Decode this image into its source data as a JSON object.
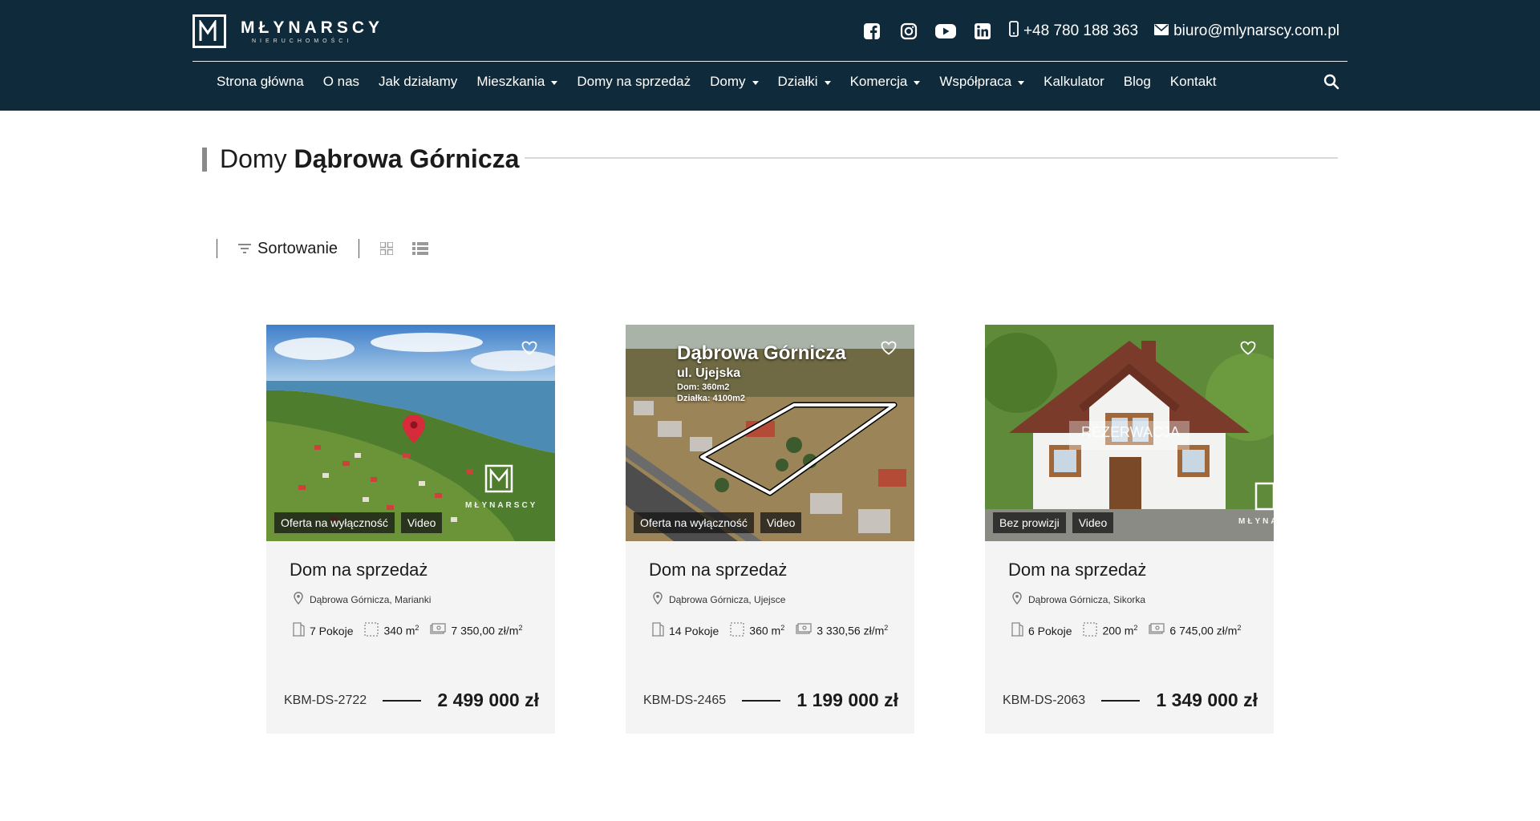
{
  "colors": {
    "header_bg": "#0f2a3a",
    "card_bg": "#f4f4f4",
    "text": "#1b1b1b",
    "pin": "#d62b3b"
  },
  "brand": {
    "name": "MŁYNARSCY",
    "subtitle": "NIERUCHOMOŚCI"
  },
  "contact": {
    "phone": "+48 780 188 363",
    "email": "biuro@mlynarscy.com.pl"
  },
  "social": [
    "facebook-icon",
    "instagram-icon",
    "youtube-icon",
    "linkedin-icon"
  ],
  "nav": {
    "items": [
      {
        "label": "Strona główna"
      },
      {
        "label": "O nas"
      },
      {
        "label": "Jak działamy"
      },
      {
        "label": "Mieszkania"
      },
      {
        "label": "Domy na sprzedaż"
      },
      {
        "label": "Domy"
      },
      {
        "label": "Działki"
      },
      {
        "label": "Komercja"
      },
      {
        "label": "Współpraca"
      },
      {
        "label": "Kalkulator"
      },
      {
        "label": "Blog"
      },
      {
        "label": "Kontakt"
      }
    ]
  },
  "page": {
    "title_light": "Domy",
    "title_bold": "Dąbrowa Górnicza"
  },
  "toolbar": {
    "sort_label": "Sortowanie"
  },
  "cards": [
    {
      "badges": [
        "Oferta na wyłączność",
        "Video"
      ],
      "title": "Dom na sprzedaż",
      "location": "Dąbrowa Górnicza, Marianki",
      "rooms": "7 Pokoje",
      "area": "340 m",
      "price_per_m": "7 350,00 zł/m",
      "code": "KBM-DS-2722",
      "price": "2 499 000 zł",
      "watermark": "MŁYNARSCY"
    },
    {
      "badges": [
        "Oferta na wyłączność",
        "Video"
      ],
      "title": "Dom na sprzedaż",
      "location": "Dąbrowa Górnicza, Ujejsce",
      "rooms": "14 Pokoje",
      "area": "360 m",
      "price_per_m": "3 330,56 zł/m",
      "code": "KBM-DS-2465",
      "price": "1 199 000 zł",
      "overlay": {
        "city": "Dąbrowa Górnicza",
        "street": "ul. Ujejska",
        "house": "Dom: 360m2",
        "plot": "Działka: 4100m2"
      }
    },
    {
      "badges": [
        "Bez prowizji",
        "Video"
      ],
      "title": "Dom na sprzedaż",
      "location": "Dąbrowa Górnicza, Sikorka",
      "rooms": "6 Pokoje",
      "area": "200 m",
      "price_per_m": "6 745,00 zł/m",
      "code": "KBM-DS-2063",
      "price": "1 349 000 zł",
      "overlay_label": "REZERWACJA",
      "watermark": "MŁYNA"
    }
  ],
  "superscript": "2"
}
